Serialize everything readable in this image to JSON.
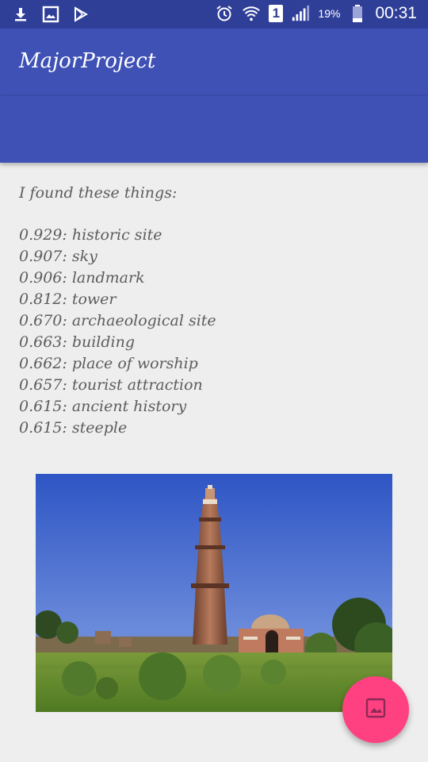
{
  "status_bar": {
    "battery_percent": "19%",
    "time": "00:31",
    "sim_slot": "1",
    "icons": [
      "download-icon",
      "image-icon",
      "play-store-icon",
      "alarm-icon",
      "wifi-icon",
      "sim-icon",
      "signal-icon",
      "battery-icon"
    ]
  },
  "app_bar": {
    "title": "MajorProject",
    "color": "#3f51b5"
  },
  "content": {
    "intro": "I found these things:",
    "results": [
      "0.929: historic site",
      "0.907: sky",
      "0.906: landmark",
      "0.812: tower",
      "0.670: archaeological site",
      "0.663: building",
      "0.662: place of worship",
      "0.657: tourist attraction",
      "0.615: ancient history",
      "0.615: steeple"
    ]
  },
  "fab": {
    "icon": "image-icon",
    "color": "#ff4081"
  }
}
